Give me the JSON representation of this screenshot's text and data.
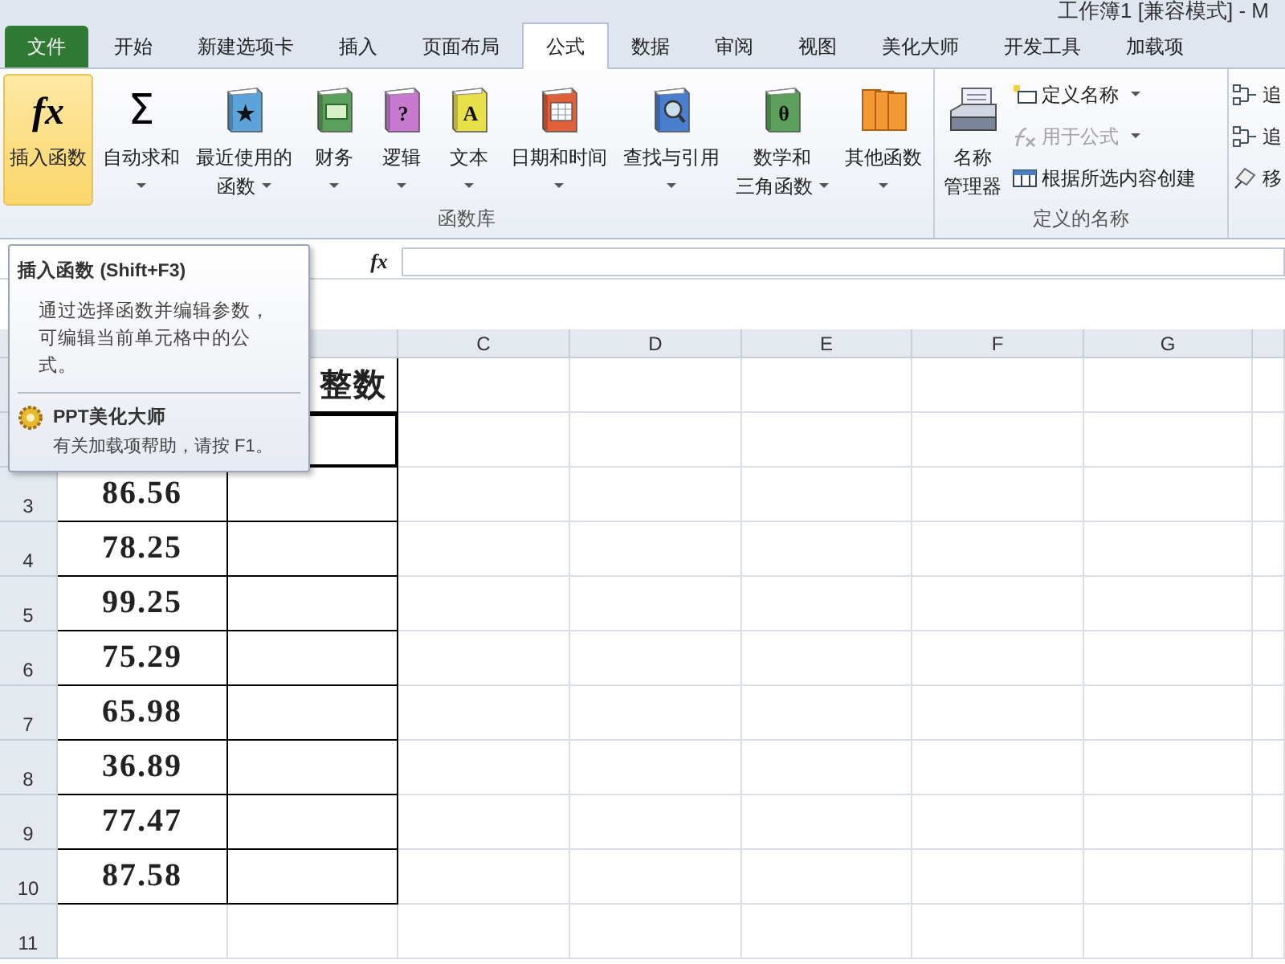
{
  "title": "工作簿1 [兼容模式] - M",
  "tabs": [
    {
      "label": "文件",
      "kind": "file",
      "selected": false
    },
    {
      "label": "开始",
      "kind": "tab",
      "selected": false
    },
    {
      "label": "新建选项卡",
      "kind": "tab",
      "selected": false
    },
    {
      "label": "插入",
      "kind": "tab",
      "selected": false
    },
    {
      "label": "页面布局",
      "kind": "tab",
      "selected": false
    },
    {
      "label": "公式",
      "kind": "tab",
      "selected": true
    },
    {
      "label": "数据",
      "kind": "tab",
      "selected": false
    },
    {
      "label": "审阅",
      "kind": "tab",
      "selected": false
    },
    {
      "label": "视图",
      "kind": "tab",
      "selected": false
    },
    {
      "label": "美化大师",
      "kind": "tab",
      "selected": false
    },
    {
      "label": "开发工具",
      "kind": "tab",
      "selected": false
    },
    {
      "label": "加载项",
      "kind": "tab",
      "selected": false
    }
  ],
  "function_library": {
    "label": "函数库",
    "buttons": [
      {
        "lines": [
          "插入函数"
        ],
        "kind": "fx",
        "glyph": "fx",
        "dropdown": false,
        "highlighted": true
      },
      {
        "lines": [
          "自动求和"
        ],
        "kind": "sigma",
        "glyph": "Σ",
        "dropdown": true,
        "highlighted": false
      },
      {
        "lines": [
          "最近使用的",
          "函数"
        ],
        "kind": "book",
        "glyph": "★",
        "color": "#5ba3d9",
        "dropdown": true,
        "highlighted": false
      },
      {
        "lines": [
          "财务"
        ],
        "kind": "money",
        "color": "#5aa05a",
        "dropdown": true,
        "highlighted": false
      },
      {
        "lines": [
          "逻辑"
        ],
        "kind": "book",
        "glyph": "?",
        "color": "#c77ad0",
        "dropdown": true,
        "highlighted": false
      },
      {
        "lines": [
          "文本"
        ],
        "kind": "book",
        "glyph": "A",
        "color": "#e8e04a",
        "dropdown": true,
        "highlighted": false
      },
      {
        "lines": [
          "日期和时间"
        ],
        "kind": "calendar",
        "color": "#e0603a",
        "dropdown": true,
        "highlighted": false
      },
      {
        "lines": [
          "查找与引用"
        ],
        "kind": "search",
        "color": "#4a7fd0",
        "dropdown": true,
        "highlighted": false
      },
      {
        "lines": [
          "数学和",
          "三角函数"
        ],
        "kind": "book",
        "glyph": "θ",
        "color": "#5aa05a",
        "dropdown": true,
        "highlighted": false
      },
      {
        "lines": [
          "其他函数"
        ],
        "kind": "books",
        "color": "#f39a34",
        "dropdown": true,
        "highlighted": false
      }
    ]
  },
  "defined_names": {
    "label": "定义的名称",
    "manager": {
      "lines": [
        "名称",
        "管理器"
      ]
    },
    "items": [
      {
        "label": "定义名称",
        "kind": "define",
        "dropdown": true,
        "disabled": false
      },
      {
        "label": "用于公式",
        "kind": "use",
        "dropdown": true,
        "disabled": true
      },
      {
        "label": "根据所选内容创建",
        "kind": "create",
        "dropdown": false,
        "disabled": false
      }
    ]
  },
  "auditing": {
    "items": [
      {
        "label": "追",
        "kind": "trace"
      },
      {
        "label": "追",
        "kind": "trace"
      },
      {
        "label": "移",
        "kind": "remove"
      }
    ]
  },
  "formula_bar": {
    "fx_label": "fx"
  },
  "sheet": {
    "columns": [
      {
        "label": "C"
      },
      {
        "label": "D"
      },
      {
        "label": "E"
      },
      {
        "label": "F"
      },
      {
        "label": "G"
      }
    ],
    "rows": [
      {
        "b": "整数",
        "selected": false
      },
      {
        "selected": true
      },
      {
        "number": "3",
        "a": "86.56",
        "selected": false
      },
      {
        "number": "4",
        "a": "78.25",
        "selected": false
      },
      {
        "number": "5",
        "a": "99.25",
        "selected": false
      },
      {
        "number": "6",
        "a": "75.29",
        "selected": false
      },
      {
        "number": "7",
        "a": "65.98",
        "selected": false
      },
      {
        "number": "8",
        "a": "36.89",
        "selected": false
      },
      {
        "number": "9",
        "a": "77.47",
        "selected": false
      },
      {
        "number": "10",
        "a": "87.58",
        "selected": false
      },
      {
        "number": "11",
        "selected": false
      }
    ]
  },
  "tooltip": {
    "title": "插入函数 (Shift+F3)",
    "body": "通过选择函数并编辑参数，可编辑当前单元格中的公式。",
    "addin_name": "PPT美化大师",
    "addin_help": "有关加载项帮助，请按 F1。"
  }
}
